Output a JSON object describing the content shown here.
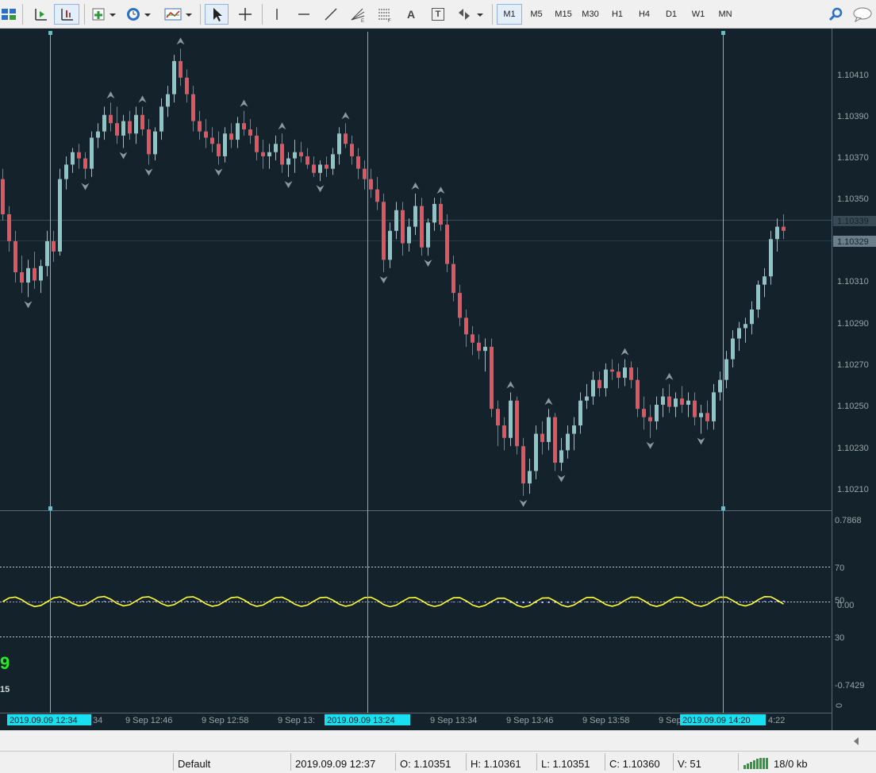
{
  "toolbar": {
    "buttons": [
      {
        "icon": "profiles-icon",
        "label": ""
      },
      {
        "icon": "chart-shift-icon",
        "label": ""
      },
      {
        "icon": "autoscroll-icon",
        "label": ""
      },
      {
        "icon": "new-chart-icon",
        "label": ""
      },
      {
        "icon": "history-clock-icon",
        "label": ""
      },
      {
        "icon": "templates-icon",
        "label": ""
      },
      {
        "icon": "cursor-arrow-icon",
        "label": ""
      },
      {
        "icon": "crosshair-icon",
        "label": ""
      },
      {
        "icon": "vertical-line-icon",
        "label": ""
      },
      {
        "icon": "horizontal-line-icon",
        "label": ""
      },
      {
        "icon": "trendline-icon",
        "label": ""
      },
      {
        "icon": "fibonacci-fan-icon",
        "label": ""
      },
      {
        "icon": "fibonacci-retracement-icon",
        "label": ""
      },
      {
        "icon": "text-icon",
        "label": "A"
      },
      {
        "icon": "text-label-icon",
        "label": "T"
      },
      {
        "icon": "arrows-icon",
        "label": ""
      }
    ],
    "timeframes": [
      "M1",
      "M5",
      "M15",
      "M30",
      "H1",
      "H4",
      "D1",
      "W1",
      "MN"
    ],
    "active_timeframe": "M1"
  },
  "price_axis": {
    "labels": [
      "1.10410",
      "1.10390",
      "1.10370",
      "1.10350",
      "1.10310",
      "1.10290",
      "1.10270",
      "1.10250",
      "1.10230",
      "1.10210"
    ],
    "marker_upper": "1.10339",
    "marker_current": "1.10329"
  },
  "indicator_axis": {
    "labels": [
      "0.7868",
      "70",
      "50",
      "0.00",
      "30",
      "-0.7429"
    ],
    "bottom_zero": "0"
  },
  "indicator_overlay": {
    "big_digit": "9",
    "small_label": "15"
  },
  "time_axis": {
    "labels": [
      "9 Sep 12:46",
      "9 Sep 12:58",
      "9 Sep 13:",
      "9 Sep 13:34",
      "9 Sep 13:46",
      "9 Sep 13:58",
      "9 Sep"
    ],
    "partial_labels": [
      "34",
      "4:22"
    ],
    "vline_labels": [
      "2019.09.09 12:34",
      "2019.09.09 13:24",
      "2019.09.09 14:20"
    ]
  },
  "status": {
    "profile": "Default",
    "datetime": "2019.09.09 12:37",
    "open": "O: 1.10351",
    "high": "H: 1.10361",
    "low": "L: 1.10351",
    "close": "C: 1.10360",
    "volume": "V: 51",
    "traffic": "18/0 kb"
  },
  "colors": {
    "background": "#14222b",
    "bull_candle": "#8fc4c4",
    "bear_candle": "#e0555e",
    "histogram_blue": "#0c0ca8",
    "histogram_white": "#ffffff",
    "signal_line": "#ffff33",
    "vertical_line": "#5ac4c8",
    "grid_text": "#9aa5ab"
  },
  "chart_data": {
    "type": "candlestick",
    "title": "",
    "xlabel": "",
    "ylabel": "",
    "ylim": [
      1.102,
      1.1043
    ],
    "series": [
      {
        "values": [
          [
            1.10355,
            1.1036,
            1.10335,
            1.10338
          ],
          [
            1.10338,
            1.10342,
            1.1032,
            1.10325
          ],
          [
            1.10325,
            1.1033,
            1.10305,
            1.1031
          ],
          [
            1.1031,
            1.10318,
            1.103,
            1.10305
          ],
          [
            1.10305,
            1.10316,
            1.10298,
            1.10312
          ],
          [
            1.10312,
            1.1032,
            1.10302,
            1.10306
          ],
          [
            1.10306,
            1.10316,
            1.103,
            1.10313
          ],
          [
            1.10313,
            1.1033,
            1.10308,
            1.10325
          ],
          [
            1.10325,
            1.1033,
            1.10315,
            1.1032
          ],
          [
            1.1032,
            1.1036,
            1.10318,
            1.10355
          ],
          [
            1.10355,
            1.10366,
            1.1035,
            1.10362
          ],
          [
            1.10362,
            1.1037,
            1.10358,
            1.10368
          ],
          [
            1.10368,
            1.10372,
            1.1036,
            1.10365
          ],
          [
            1.10365,
            1.10368,
            1.10355,
            1.1036
          ],
          [
            1.1036,
            1.10378,
            1.10356,
            1.10375
          ],
          [
            1.10375,
            1.10382,
            1.1037,
            1.10378
          ],
          [
            1.10378,
            1.1039,
            1.10374,
            1.10386
          ],
          [
            1.10386,
            1.10392,
            1.10378,
            1.10382
          ],
          [
            1.10382,
            1.1039,
            1.10372,
            1.10376
          ],
          [
            1.10376,
            1.10386,
            1.1037,
            1.10383
          ],
          [
            1.10383,
            1.10388,
            1.10374,
            1.10377
          ],
          [
            1.10377,
            1.1039,
            1.10372,
            1.10386
          ],
          [
            1.10386,
            1.1039,
            1.10376,
            1.10379
          ],
          [
            1.10379,
            1.10384,
            1.10362,
            1.10367
          ],
          [
            1.10367,
            1.1038,
            1.10364,
            1.10378
          ],
          [
            1.10378,
            1.10394,
            1.10374,
            1.1039
          ],
          [
            1.1039,
            1.104,
            1.10385,
            1.10396
          ],
          [
            1.10396,
            1.10415,
            1.10392,
            1.10412
          ],
          [
            1.10412,
            1.10418,
            1.104,
            1.10404
          ],
          [
            1.10404,
            1.10408,
            1.10392,
            1.10396
          ],
          [
            1.10396,
            1.104,
            1.10378,
            1.10383
          ],
          [
            1.10383,
            1.10388,
            1.10374,
            1.10378
          ],
          [
            1.10378,
            1.10384,
            1.1037,
            1.10375
          ],
          [
            1.10375,
            1.1038,
            1.10368,
            1.10372
          ],
          [
            1.10372,
            1.10378,
            1.10362,
            1.10366
          ],
          [
            1.10366,
            1.1038,
            1.10363,
            1.10377
          ],
          [
            1.10377,
            1.10382,
            1.1037,
            1.10374
          ],
          [
            1.10374,
            1.10385,
            1.1037,
            1.10382
          ],
          [
            1.10382,
            1.10388,
            1.10376,
            1.10379
          ],
          [
            1.10379,
            1.10384,
            1.10372,
            1.10376
          ],
          [
            1.10376,
            1.1038,
            1.10364,
            1.10368
          ],
          [
            1.10368,
            1.10374,
            1.1036,
            1.10366
          ],
          [
            1.10366,
            1.10372,
            1.1036,
            1.10368
          ],
          [
            1.10368,
            1.10376,
            1.10364,
            1.10372
          ],
          [
            1.10372,
            1.10377,
            1.10358,
            1.10362
          ],
          [
            1.10362,
            1.10368,
            1.10356,
            1.10365
          ],
          [
            1.10365,
            1.10374,
            1.10358,
            1.10368
          ],
          [
            1.10368,
            1.10373,
            1.10363,
            1.10366
          ],
          [
            1.10366,
            1.1037,
            1.1036,
            1.10362
          ],
          [
            1.10362,
            1.10366,
            1.10356,
            1.10358
          ],
          [
            1.10358,
            1.10364,
            1.10354,
            1.10362
          ],
          [
            1.10362,
            1.10366,
            1.10356,
            1.1036
          ],
          [
            1.1036,
            1.1037,
            1.10357,
            1.10367
          ],
          [
            1.10367,
            1.1038,
            1.10362,
            1.10377
          ],
          [
            1.10377,
            1.10382,
            1.1037,
            1.10372
          ],
          [
            1.10372,
            1.10376,
            1.10362,
            1.10366
          ],
          [
            1.10366,
            1.1037,
            1.10355,
            1.1036
          ],
          [
            1.1036,
            1.10364,
            1.1035,
            1.10355
          ],
          [
            1.10355,
            1.1036,
            1.10346,
            1.1035
          ],
          [
            1.1035,
            1.10356,
            1.1034,
            1.10344
          ],
          [
            1.10344,
            1.10348,
            1.1031,
            1.10316
          ],
          [
            1.10316,
            1.10334,
            1.10312,
            1.1033
          ],
          [
            1.1033,
            1.10344,
            1.10326,
            1.1034
          ],
          [
            1.1034,
            1.10344,
            1.10318,
            1.10324
          ],
          [
            1.10324,
            1.10336,
            1.1032,
            1.10332
          ],
          [
            1.10332,
            1.10348,
            1.10328,
            1.10342
          ],
          [
            1.10342,
            1.10346,
            1.10318,
            1.10322
          ],
          [
            1.10322,
            1.10336,
            1.10318,
            1.10334
          ],
          [
            1.10334,
            1.10346,
            1.1033,
            1.10343
          ],
          [
            1.10343,
            1.10346,
            1.1033,
            1.10333
          ],
          [
            1.10333,
            1.10338,
            1.1031,
            1.10314
          ],
          [
            1.10314,
            1.10318,
            1.10296,
            1.103
          ],
          [
            1.103,
            1.10304,
            1.10284,
            1.10288
          ],
          [
            1.10288,
            1.10292,
            1.10274,
            1.1028
          ],
          [
            1.1028,
            1.10284,
            1.1027,
            1.10276
          ],
          [
            1.10276,
            1.1028,
            1.10268,
            1.10272
          ],
          [
            1.10272,
            1.10278,
            1.10262,
            1.10274
          ],
          [
            1.10274,
            1.10278,
            1.1024,
            1.10244
          ],
          [
            1.10244,
            1.10248,
            1.10226,
            1.10236
          ],
          [
            1.10236,
            1.1024,
            1.10224,
            1.1023
          ],
          [
            1.1023,
            1.10252,
            1.10226,
            1.10248
          ],
          [
            1.10248,
            1.1025,
            1.10222,
            1.10226
          ],
          [
            1.10226,
            1.1023,
            1.10202,
            1.10208
          ],
          [
            1.10208,
            1.1022,
            1.10203,
            1.10214
          ],
          [
            1.10214,
            1.10236,
            1.1021,
            1.10232
          ],
          [
            1.10232,
            1.10238,
            1.10222,
            1.10228
          ],
          [
            1.10228,
            1.10244,
            1.10224,
            1.1024
          ],
          [
            1.1024,
            1.10242,
            1.10214,
            1.10218
          ],
          [
            1.10218,
            1.1023,
            1.10214,
            1.10224
          ],
          [
            1.10224,
            1.10236,
            1.1022,
            1.10232
          ],
          [
            1.10232,
            1.1024,
            1.10224,
            1.10236
          ],
          [
            1.10236,
            1.10252,
            1.10232,
            1.10248
          ],
          [
            1.10248,
            1.10256,
            1.10244,
            1.1025
          ],
          [
            1.1025,
            1.10262,
            1.10246,
            1.10258
          ],
          [
            1.10258,
            1.10262,
            1.1025,
            1.10254
          ],
          [
            1.10254,
            1.10266,
            1.1025,
            1.10263
          ],
          [
            1.10263,
            1.10268,
            1.10258,
            1.10262
          ],
          [
            1.10262,
            1.10266,
            1.10254,
            1.10259
          ],
          [
            1.10259,
            1.10268,
            1.10255,
            1.10264
          ],
          [
            1.10264,
            1.10267,
            1.10254,
            1.10258
          ],
          [
            1.10258,
            1.10264,
            1.1024,
            1.10244
          ],
          [
            1.10244,
            1.1025,
            1.10234,
            1.1024
          ],
          [
            1.1024,
            1.10246,
            1.1023,
            1.10238
          ],
          [
            1.10238,
            1.1025,
            1.10234,
            1.10246
          ],
          [
            1.10246,
            1.10254,
            1.1024,
            1.1025
          ],
          [
            1.1025,
            1.10256,
            1.10242,
            1.10245
          ],
          [
            1.10245,
            1.10252,
            1.1024,
            1.10249
          ],
          [
            1.10249,
            1.10255,
            1.10242,
            1.10246
          ],
          [
            1.10246,
            1.10252,
            1.1024,
            1.10248
          ],
          [
            1.10248,
            1.10252,
            1.10236,
            1.1024
          ],
          [
            1.1024,
            1.10246,
            1.10232,
            1.10242
          ],
          [
            1.10242,
            1.10248,
            1.10234,
            1.10238
          ],
          [
            1.10238,
            1.10256,
            1.10234,
            1.10252
          ],
          [
            1.10252,
            1.10262,
            1.10248,
            1.10258
          ],
          [
            1.10258,
            1.10272,
            1.10254,
            1.10268
          ],
          [
            1.10268,
            1.10282,
            1.10264,
            1.10278
          ],
          [
            1.10278,
            1.10286,
            1.10272,
            1.10283
          ],
          [
            1.10283,
            1.10288,
            1.10276,
            1.10285
          ],
          [
            1.10285,
            1.10296,
            1.1028,
            1.10292
          ],
          [
            1.10292,
            1.10306,
            1.10288,
            1.10304
          ],
          [
            1.10304,
            1.10312,
            1.10298,
            1.10308
          ],
          [
            1.10308,
            1.1033,
            1.10304,
            1.10326
          ],
          [
            1.10326,
            1.10336,
            1.1032,
            1.10332
          ],
          [
            1.10332,
            1.10338,
            1.10326,
            1.1033
          ]
        ]
      }
    ]
  }
}
